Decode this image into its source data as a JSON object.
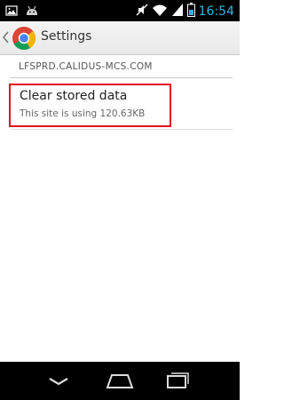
{
  "status_bar": {
    "time": "16:54",
    "time_color": "#33b5e5",
    "left_icons": [
      "gallery-notification-icon",
      "android-notification-icon"
    ],
    "right_icons": [
      "no-sound-icon",
      "wifi-icon",
      "signal-icon",
      "battery-icon"
    ]
  },
  "action_bar": {
    "title": "Settings",
    "icons": [
      "back-caret-icon",
      "chrome-logo-icon"
    ]
  },
  "site": {
    "header": "LFSPRD.CALIDUS-MCS.COM"
  },
  "preference": {
    "title": "Clear stored data",
    "summary": "This site is using 120.63KB",
    "highlight_color": "#e0111b"
  },
  "nav_bar": {
    "icons": [
      "nav-back-icon",
      "nav-home-icon",
      "nav-recent-apps-icon"
    ]
  }
}
